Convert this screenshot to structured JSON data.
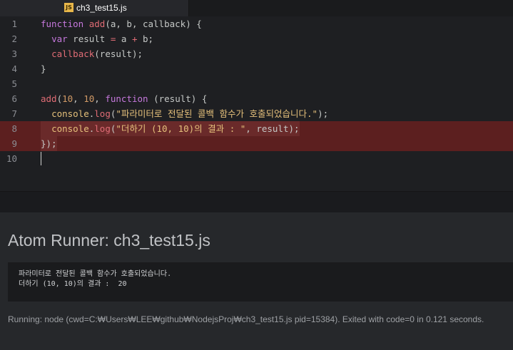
{
  "tab": {
    "title": "ch3_test15.js",
    "icon": "js-file-icon",
    "icon_label": "JS"
  },
  "editor": {
    "lines": [
      {
        "num": "1",
        "tokens": [
          "function",
          " ",
          "add",
          "(a, b, callback) {"
        ]
      },
      {
        "num": "2",
        "tokens": [
          "  ",
          "var",
          " result ",
          "=",
          " a ",
          "+",
          " b;"
        ]
      },
      {
        "num": "3",
        "tokens": [
          "  ",
          "callback",
          "(result);"
        ]
      },
      {
        "num": "4",
        "tokens": [
          "}"
        ]
      },
      {
        "num": "5",
        "tokens": [
          ""
        ]
      },
      {
        "num": "6",
        "tokens": [
          "add",
          "(",
          "10",
          ", ",
          "10",
          ", ",
          "function",
          " (result) {"
        ]
      },
      {
        "num": "7",
        "tokens": [
          "  ",
          "console",
          ".",
          "log",
          "(",
          "\"파라미터로 전달된 콜백 함수가 호출되었습니다.\"",
          ");"
        ]
      },
      {
        "num": "8",
        "tokens": [
          "  ",
          "console",
          ".",
          "log",
          "(",
          "\"더하기 (10, 10)의 결과 : \"",
          ", result);"
        ]
      },
      {
        "num": "9",
        "tokens": [
          "});"
        ]
      },
      {
        "num": "10",
        "tokens": [
          ""
        ]
      }
    ],
    "highlight_color": "#5c1f1f"
  },
  "runner": {
    "title": "Atom Runner: ch3_test15.js",
    "output": [
      "파라미터로 전달된 콜백 함수가 호출되었습니다.",
      "더하기 (10, 10)의 결과 :  20"
    ],
    "status": "Running: node (cwd=C:₩Users₩LEE₩github₩NodejsProj₩ch3_test15.js pid=15384). Exited with code=0 in 0.121 seconds."
  }
}
